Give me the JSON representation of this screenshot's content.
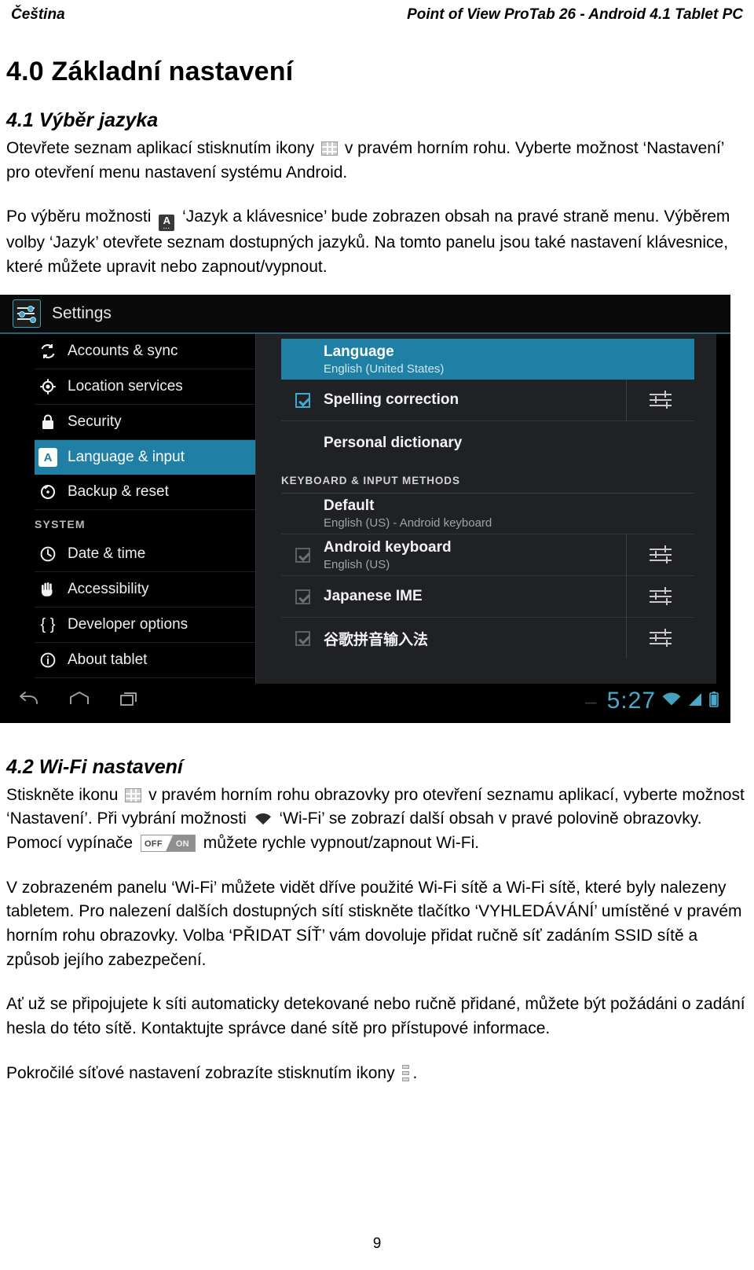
{
  "header": {
    "left": "Čeština",
    "right": "Point of View ProTab 26 - Android 4.1 Tablet PC"
  },
  "document": {
    "section_title": "4.0 Základní nastavení",
    "subsection_41": "4.1 Výběr jazyka",
    "p41_a_1": "Otevřete seznam aplikací stisknutím ikony",
    "p41_a_2": "v pravém horním rohu. Vyberte možnost ‘Nastavení’ pro otevření menu nastavení systému Android.",
    "p41_b_1": "Po výběru možnosti",
    "p41_b_2": "‘Jazyk a klávesnice’ bude zobrazen obsah na pravé straně menu. Výběrem volby ‘Jazyk’ otevřete seznam dostupných jazyků. Na tomto panelu jsou také nastavení klávesnice, které můžete upravit nebo zapnout/vypnout.",
    "subsection_42": "4.2 Wi-Fi nastavení",
    "p42_a_1": "Stiskněte ikonu",
    "p42_a_2": "v pravém horním rohu obrazovky pro otevření seznamu aplikací, vyberte možnost ‘Nastavení’. Při vybrání možnosti",
    "p42_a_3": "‘Wi-Fi’ se zobrazí další obsah v pravé polovině obrazovky. Pomocí vypínače",
    "p42_a_4": "můžete rychle vypnout/zapnout Wi-Fi.",
    "p42_b": "V zobrazeném panelu ‘Wi-Fi’ můžete vidět dříve použité Wi-Fi sítě a Wi-Fi sítě, které byly nalezeny tabletem. Pro nalezení dalších dostupných sítí stiskněte tlačítko ‘VYHLEDÁVÁNÍ’ umístěné v pravém horním rohu obrazovky. Volba ‘PŘIDAT SÍŤ’ vám dovoluje přidat ručně síť zadáním SSID sítě a způsob jejího zabezpečení.",
    "p42_c": "Ať už se připojujete k síti automaticky detekované nebo ručně přidané, můžete být požádáni o zadání hesla do této sítě. Kontaktujte správce dané sítě pro přístupové informace.",
    "p42_d_1": "Pokročilé síťové nastavení zobrazíte stisknutím ikony",
    "p42_d_2": ".",
    "page_number": "9"
  },
  "inline_icons": {
    "apps_grid": "apps-grid-icon",
    "language_badge": "language-input-icon",
    "wifi": "wifi-icon",
    "toggle_off_label": "OFF",
    "toggle_on_label": "ON",
    "overflow": "overflow-menu-icon"
  },
  "screenshot": {
    "app_title": "Settings",
    "nav_items": [
      {
        "label": "Accounts & sync",
        "icon": "sync-icon",
        "selected": false
      },
      {
        "label": "Location services",
        "icon": "location-icon",
        "selected": false
      },
      {
        "label": "Security",
        "icon": "lock-icon",
        "selected": false
      },
      {
        "label": "Language & input",
        "icon": "language-badge-icon",
        "selected": true
      },
      {
        "label": "Backup & reset",
        "icon": "backup-reset-icon",
        "selected": false
      }
    ],
    "nav_group_label": "SYSTEM",
    "nav_items_system": [
      {
        "label": "Date & time",
        "icon": "clock-icon",
        "selected": false
      },
      {
        "label": "Accessibility",
        "icon": "hand-icon",
        "selected": false
      },
      {
        "label": "Developer options",
        "icon": "braces-icon",
        "selected": false
      },
      {
        "label": "About tablet",
        "icon": "info-icon",
        "selected": false
      }
    ],
    "pane": {
      "language_title": "Language",
      "language_value": "English (United States)",
      "spelling_title": "Spelling correction",
      "personal_dictionary": "Personal dictionary",
      "keyboard_group_label": "KEYBOARD & INPUT METHODS",
      "default_title": "Default",
      "default_value": "English (US) - Android keyboard",
      "methods": [
        {
          "title": "Android keyboard",
          "subtitle": "English (US)"
        },
        {
          "title": "Japanese IME",
          "subtitle": ""
        },
        {
          "title": "谷歌拼音输入法",
          "subtitle": ""
        }
      ]
    },
    "system_bar": {
      "back": "back-icon",
      "home": "home-icon",
      "recents": "recents-icon",
      "clock": "5:27",
      "wifi": "wifi-status-icon",
      "signal": "signal-status-icon",
      "battery": "battery-status-icon"
    },
    "colors": {
      "accent": "#1f7fa5",
      "pane_bg": "#1f2124",
      "clock": "#4aa8c9"
    }
  }
}
